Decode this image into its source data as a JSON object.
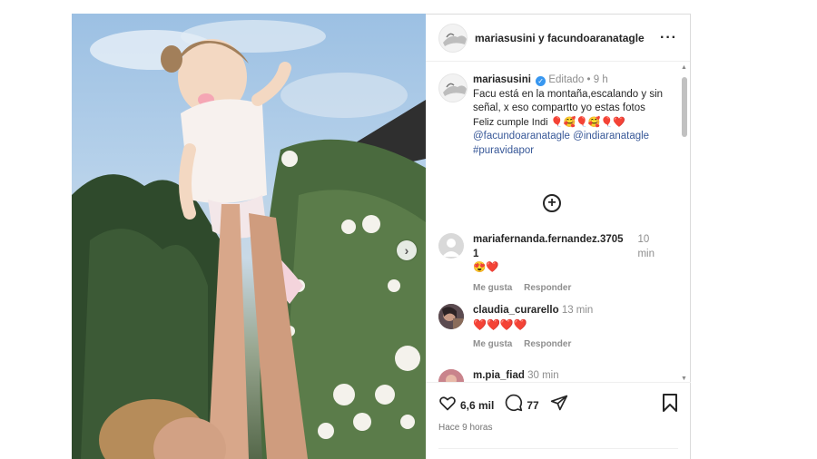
{
  "post": {
    "header_title": "mariasusini y facundoaranatagle",
    "more_icon": "more-horizontal-icon"
  },
  "caption": {
    "username": "mariasusini",
    "edited": "Editado",
    "separator": "•",
    "time": "9 h",
    "text_line1": "Facu está en la montaña,escalando y sin",
    "text_line2": "señal, x eso compartto yo estas fotos",
    "text_line3": "Feliz cumple Indi",
    "emojis": "🎈🥰🎈🥰🎈❤️",
    "mention1": "@facundoaranatagle",
    "mention2": "@indiaranatagle",
    "hashtag": "#puravidapor"
  },
  "comments": [
    {
      "username_line1": "mariafernanda.fernandez.3705",
      "username_line2": "1",
      "time_line1": "10",
      "time_line2": "min",
      "text": "😍❤️",
      "like": "Me gusta",
      "reply": "Responder"
    },
    {
      "username": "claudia_curarello",
      "time": "13 min",
      "text": "❤️❤️❤️❤️",
      "like": "Me gusta",
      "reply": "Responder"
    },
    {
      "username": "m.pia_fiad",
      "time": "30 min"
    }
  ],
  "actions": {
    "likes": "6,6 mil",
    "comments": "77",
    "time_ago": "Hace 9 horas"
  },
  "colors": {
    "accent": "#3897f0",
    "heart": "#e0243a",
    "link": "#385898"
  }
}
